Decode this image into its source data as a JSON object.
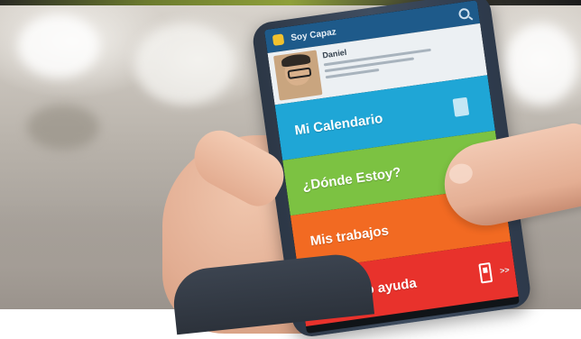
{
  "app": {
    "title": "Soy Capaz",
    "profile_name": "Daniel"
  },
  "menu": {
    "items": [
      {
        "label": "Mi Calendario",
        "color": "#1fa6d6",
        "icon": "calendar-icon"
      },
      {
        "label": "¿Dónde Estoy?",
        "color": "#7cc242",
        "icon": "network-icon"
      },
      {
        "label": "Mis trabajos",
        "color": "#f26a22",
        "icon": ""
      },
      {
        "label": "Necesito ayuda",
        "color": "#e8322c",
        "icon": "phone-icon"
      }
    ],
    "chevron": ">>"
  },
  "colors": {
    "appbar": "#1e5a8a",
    "phone_body": "#2c3746"
  }
}
